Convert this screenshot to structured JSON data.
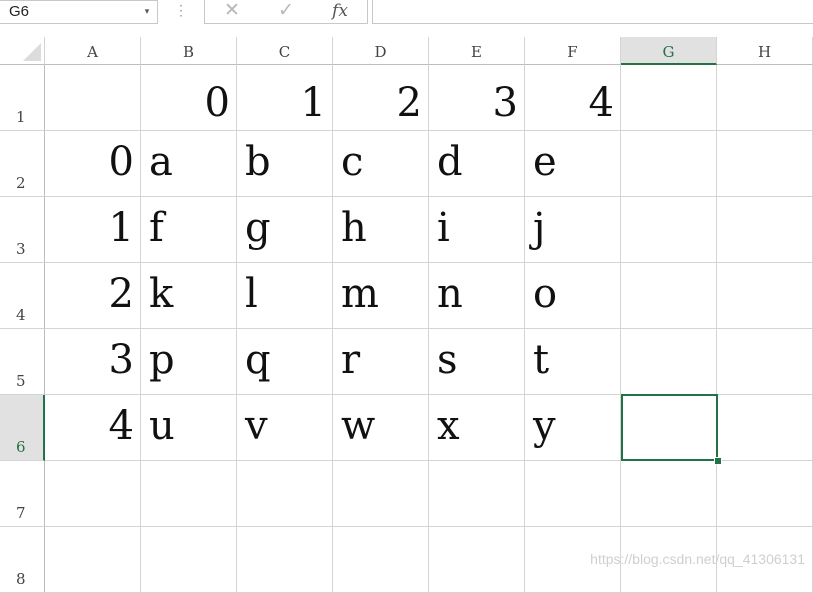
{
  "formula_bar": {
    "name_box": "G6",
    "name_box_arrow": "▾",
    "more_icon": "⋮",
    "cancel_icon": "✕",
    "enter_icon": "✓",
    "fx_label": "fx",
    "formula": ""
  },
  "columns": [
    "A",
    "B",
    "C",
    "D",
    "E",
    "F",
    "G",
    "H"
  ],
  "rows": [
    "1",
    "2",
    "3",
    "4",
    "5",
    "6",
    "7",
    "8"
  ],
  "selected_cell": "G6",
  "grid": [
    [
      "",
      "0",
      "1",
      "2",
      "3",
      "4",
      "",
      ""
    ],
    [
      "0",
      "a",
      "b",
      "c",
      "d",
      "e",
      "",
      ""
    ],
    [
      "1",
      "f",
      "g",
      "h",
      "i",
      "j",
      "",
      ""
    ],
    [
      "2",
      "k",
      "l",
      "m",
      "n",
      "o",
      "",
      ""
    ],
    [
      "3",
      "p",
      "q",
      "r",
      "s",
      "t",
      "",
      ""
    ],
    [
      "4",
      "u",
      "v",
      "w",
      "x",
      "y",
      "",
      ""
    ],
    [
      "",
      "",
      "",
      "",
      "",
      "",
      "",
      ""
    ],
    [
      "",
      "",
      "",
      "",
      "",
      "",
      "",
      ""
    ]
  ],
  "watermark": "https://blog.csdn.net/qq_41306131",
  "colors": {
    "accent": "#217346",
    "gridline": "#d4d4d4",
    "header_selected_bg": "#e1e1e1"
  }
}
